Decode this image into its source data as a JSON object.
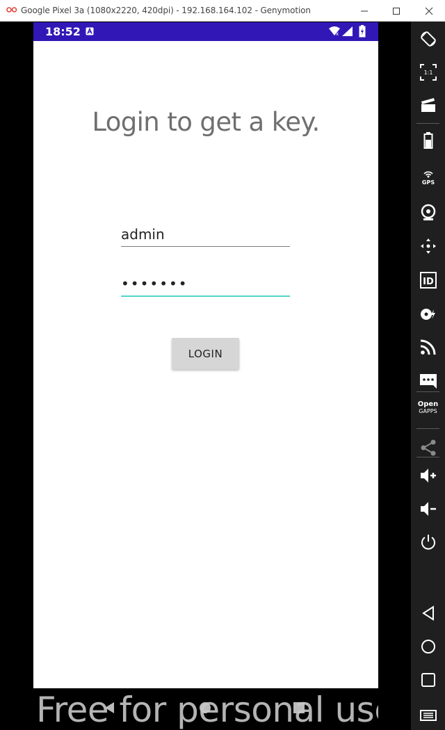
{
  "window": {
    "title": "Google Pixel 3a (1080x2220, 420dpi) - 192.168.164.102 - Genymotion"
  },
  "status_bar": {
    "time": "18:52",
    "color": "#3217b7"
  },
  "screen": {
    "heading": "Login to get a key.",
    "username_value": "admin",
    "password_value": "•••••••",
    "login_label": "LOGIN",
    "accent_color": "#53d4cd"
  },
  "watermark": "Free for personal use",
  "toolbar": {
    "items": [
      {
        "icon": "rotate-icon"
      },
      {
        "icon": "pixel-perfect-icon",
        "text": "1:1"
      },
      {
        "icon": "screen-record-icon"
      },
      {
        "icon": "battery-icon"
      },
      {
        "icon": "gps-icon",
        "text": "GPS"
      },
      {
        "icon": "webcam-icon"
      },
      {
        "icon": "dpad-icon"
      },
      {
        "icon": "identifiers-icon",
        "text": "ID"
      },
      {
        "icon": "disk-io-icon"
      },
      {
        "icon": "network-icon"
      },
      {
        "icon": "sms-icon"
      },
      {
        "icon": "open-gapps-icon",
        "text": "Open GAPPS"
      },
      {
        "icon": "share-icon"
      },
      {
        "icon": "volume-up-icon"
      },
      {
        "icon": "volume-down-icon"
      },
      {
        "icon": "power-icon"
      },
      {
        "icon": "back-icon"
      },
      {
        "icon": "home-icon"
      },
      {
        "icon": "recent-apps-icon"
      },
      {
        "icon": "menu-icon"
      }
    ]
  }
}
